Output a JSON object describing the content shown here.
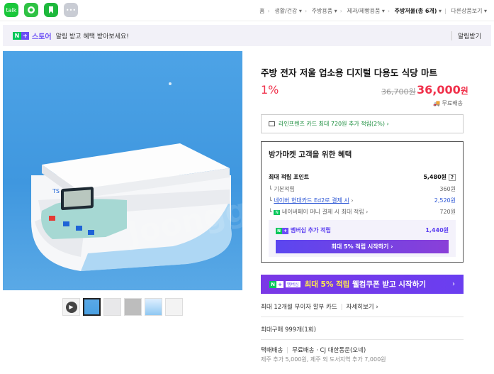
{
  "share": {
    "talk": "talk"
  },
  "breadcrumb": {
    "items": [
      "홈",
      "생활/건강",
      "주방용품",
      "제과/제빵용품",
      "주방저울(총 6개)",
      "다른상품보기"
    ]
  },
  "alert": {
    "store_label": "스토어",
    "text": "알림 받고 혜택 받아보세요!",
    "button": "알림받기"
  },
  "product": {
    "title": "주방 전자 저울 업소용 디지털 다용도 식당 마트",
    "discount": "1%",
    "original_price": "36,700원",
    "price": "36,000",
    "price_unit": "원",
    "shipping": "무료배송",
    "watermark": "Joongg"
  },
  "card_promo": "라인프렌즈 카드 최대 720원 추가 적립(2%)",
  "benefit": {
    "title": "방가마켓 고객을 위한 혜택",
    "max_points_label": "최대 적립 포인트",
    "max_points": "5,480원",
    "help": "?",
    "rows": [
      {
        "label": "기본적립",
        "value": "360원"
      },
      {
        "label": "네이버 현대카드 Ed2로 결제 시",
        "value": "2,520원"
      },
      {
        "label": "네이버페이 머니 결제 시 최대 적립",
        "value": "720원"
      }
    ],
    "npay_tag": "N",
    "member_label": "멤버십 추가 적립",
    "member_value": "1,440원",
    "member_button": "최대 5% 적립 시작하기"
  },
  "promo": {
    "membership_tag": "멤버십",
    "highlight": "최대 5% 적립",
    "text": "웰컴쿠폰 받고 시작하기",
    "arrow": "›"
  },
  "installment": {
    "text": "최대 12개월 무이자 할부 카드",
    "link": "자세히보기"
  },
  "purchase_limit": "최대구매 999개(1회)",
  "delivery": {
    "type": "택배배송",
    "fee": "무료배송",
    "carrier": "CJ 대한통운(오네)",
    "extra": "제주 추가 5,000원, 제주 외 도서지역 추가 7,000원"
  },
  "colors": {
    "accent": "#6b4ef6",
    "price": "#f0304a",
    "naver_green": "#03c75a"
  },
  "thumbnails": [
    "video",
    "scale-blue",
    "scale-gray",
    "scale-box",
    "scale-sky",
    "scale-white"
  ]
}
